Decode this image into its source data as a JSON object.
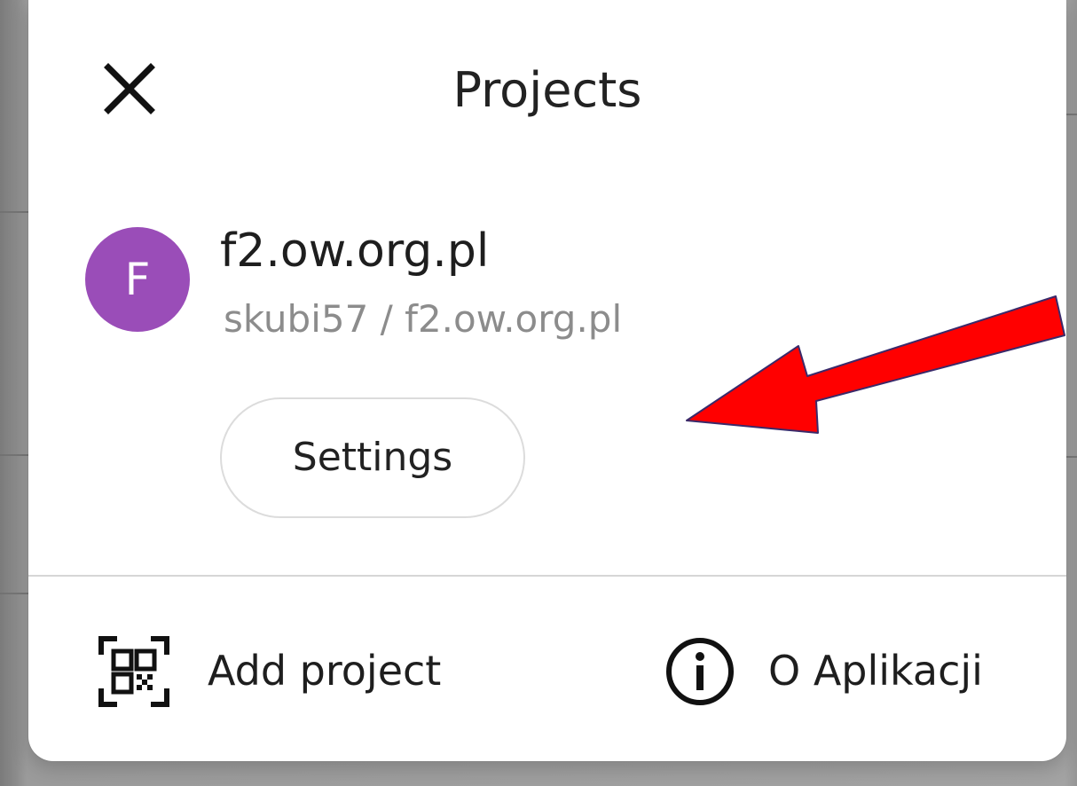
{
  "header": {
    "title": "Projects",
    "close_icon": "close-icon"
  },
  "project": {
    "avatar_letter": "F",
    "avatar_color": "#9a4db8",
    "name": "f2.ow.org.pl",
    "path": "skubi57 / f2.ow.org.pl",
    "settings_label": "Settings"
  },
  "footer": {
    "add_project_label": "Add project",
    "add_project_icon": "qr-code-scan-icon",
    "about_label": "O Aplikacji",
    "about_icon": "info-icon"
  },
  "annotation": {
    "arrow_color": "#ff0000",
    "arrow_icon": "red-arrow-icon"
  }
}
